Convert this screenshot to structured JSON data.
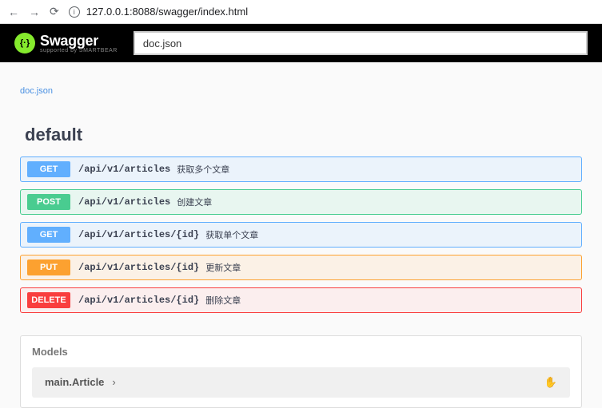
{
  "browser": {
    "url": "127.0.0.1:8088/swagger/index.html"
  },
  "header": {
    "logo_mark": "{·}",
    "logo_text": "Swagger",
    "logo_sub": "supported by SMARTBEAR",
    "search_value": "doc.json"
  },
  "doc_link": "doc.json",
  "section": "default",
  "endpoints": [
    {
      "method": "GET",
      "cls": "ep-get",
      "path": "/api/v1/articles",
      "summary": "获取多个文章"
    },
    {
      "method": "POST",
      "cls": "ep-post",
      "path": "/api/v1/articles",
      "summary": "创建文章"
    },
    {
      "method": "GET",
      "cls": "ep-get",
      "path": "/api/v1/articles/{id}",
      "summary": "获取单个文章"
    },
    {
      "method": "PUT",
      "cls": "ep-put",
      "path": "/api/v1/articles/{id}",
      "summary": "更新文章"
    },
    {
      "method": "DELETE",
      "cls": "ep-delete",
      "path": "/api/v1/articles/{id}",
      "summary": "删除文章"
    }
  ],
  "models": {
    "title": "Models",
    "items": [
      {
        "name": "main.Article"
      }
    ]
  }
}
